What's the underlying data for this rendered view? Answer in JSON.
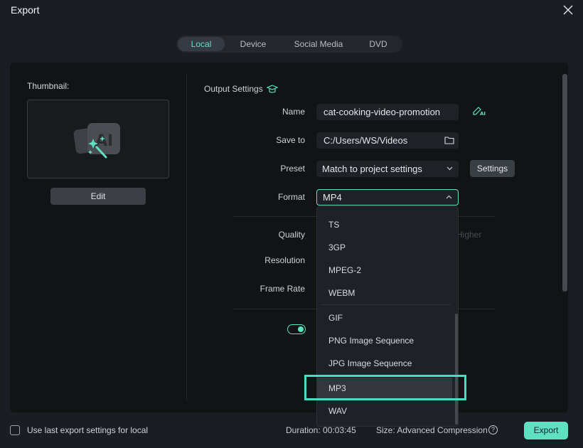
{
  "window": {
    "title": "Export"
  },
  "tabs": [
    {
      "label": "Local",
      "active": true
    },
    {
      "label": "Device",
      "active": false
    },
    {
      "label": "Social Media",
      "active": false
    },
    {
      "label": "DVD",
      "active": false
    }
  ],
  "thumbnail": {
    "label": "Thumbnail:",
    "edit_label": "Edit",
    "icon": "ai-magic-wand-icon"
  },
  "output_settings": {
    "heading": "Output Settings",
    "name": {
      "label": "Name",
      "value": "cat-cooking-video-promotion"
    },
    "save_to": {
      "label": "Save to",
      "value": "C:/Users/WS/Videos"
    },
    "preset": {
      "label": "Preset",
      "value": "Match to project settings",
      "settings_label": "Settings"
    },
    "format": {
      "label": "Format",
      "value": "MP4"
    },
    "quality": {
      "label": "Quality",
      "right_label": "Higher"
    },
    "resolution": {
      "label": "Resolution"
    },
    "frame_rate": {
      "label": "Frame Rate"
    },
    "toggle_on": true
  },
  "format_dropdown": {
    "options": [
      "TS",
      "3GP",
      "MPEG-2",
      "WEBM",
      "GIF",
      "PNG Image Sequence",
      "JPG Image Sequence",
      "MP3",
      "WAV"
    ],
    "highlighted": "MP3"
  },
  "footer": {
    "checkbox_label": "Use last export settings for local",
    "checkbox_checked": false,
    "duration": "Duration: 00:03:45",
    "size": "Size: Advanced Compression",
    "export_label": "Export"
  },
  "colors": {
    "accent": "#5fe0c0",
    "callout": "#49dcc0",
    "background": "#1b1d24",
    "panel": "#111414"
  }
}
